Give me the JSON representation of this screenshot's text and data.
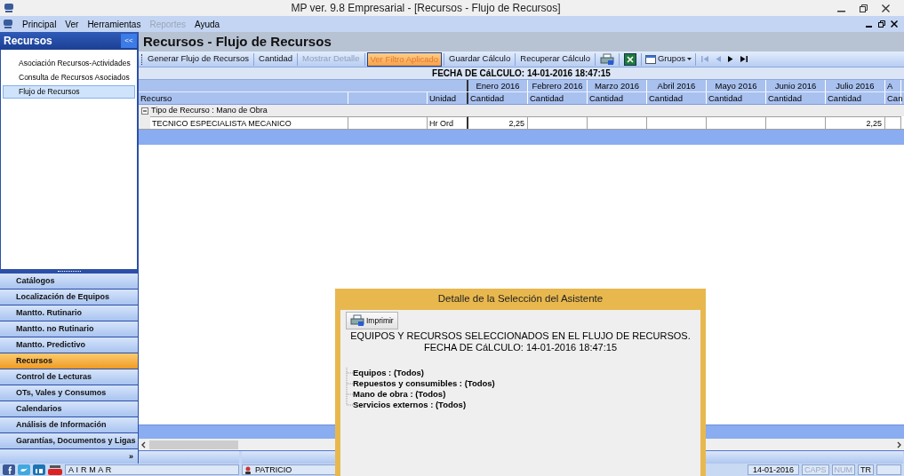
{
  "window": {
    "title": "MP ver. 9.8 Empresarial - [Recursos - Flujo de Recursos]"
  },
  "menu": [
    {
      "label": "Principal",
      "disabled": false
    },
    {
      "label": "Ver",
      "disabled": false
    },
    {
      "label": "Herramientas",
      "disabled": false
    },
    {
      "label": "Reportes",
      "disabled": true
    },
    {
      "label": "Ayuda",
      "disabled": false
    }
  ],
  "sidebar": {
    "title": "Recursos",
    "collapse": "<<",
    "items": [
      {
        "label": "Asociación Recursos-Actividades",
        "selected": false
      },
      {
        "label": "Consulta de Recursos Asociados",
        "selected": false
      },
      {
        "label": "Flujo de Recursos",
        "selected": true
      }
    ],
    "nav": [
      {
        "label": "Catálogos",
        "selected": false
      },
      {
        "label": "Localización de Equipos",
        "selected": false
      },
      {
        "label": "Mantto. Rutinario",
        "selected": false
      },
      {
        "label": "Mantto. no Rutinario",
        "selected": false
      },
      {
        "label": "Mantto. Predictivo",
        "selected": false
      },
      {
        "label": "Recursos",
        "selected": true
      },
      {
        "label": "Control de Lecturas",
        "selected": false
      },
      {
        "label": "OTs, Vales y Consumos",
        "selected": false
      },
      {
        "label": "Calendarios",
        "selected": false
      },
      {
        "label": "Análisis de Información",
        "selected": false
      },
      {
        "label": "Garantías, Documentos y Ligas",
        "selected": false
      }
    ],
    "more": "»"
  },
  "page": {
    "title": "Recursos - Flujo de Recursos"
  },
  "toolbar": [
    {
      "kind": "text",
      "label": "Generar Flujo de Recursos",
      "disabled": false,
      "highlighted": false
    },
    {
      "kind": "text",
      "label": "Cantidad",
      "disabled": false,
      "highlighted": false
    },
    {
      "kind": "text",
      "label": "Mostrar Detalle",
      "disabled": true,
      "highlighted": false
    },
    {
      "kind": "text",
      "label": "Ver Filtro Aplicado",
      "disabled": false,
      "highlighted": true
    },
    {
      "kind": "text",
      "label": "Guardar Cálculo",
      "disabled": false,
      "highlighted": false
    },
    {
      "kind": "text",
      "label": "Recuperar Cálculo",
      "disabled": false,
      "highlighted": false
    },
    {
      "kind": "print"
    },
    {
      "kind": "excel"
    },
    {
      "kind": "menu",
      "label": "Grupos",
      "disabled": false
    },
    {
      "kind": "first",
      "disabled": true
    },
    {
      "kind": "prev",
      "disabled": true
    },
    {
      "kind": "next",
      "disabled": false
    },
    {
      "kind": "last",
      "disabled": false
    }
  ],
  "calc_date": "FECHA DE CáLCULO: 14-01-2016 18:47:15",
  "table": {
    "resource_header": "Recurso",
    "unit_header": "Unidad",
    "months": [
      {
        "label": "Enero 2016",
        "sub": "Cantidad"
      },
      {
        "label": "Febrero 2016",
        "sub": "Cantidad"
      },
      {
        "label": "Marzo 2016",
        "sub": "Cantidad"
      },
      {
        "label": "Abril 2016",
        "sub": "Cantidad"
      },
      {
        "label": "Mayo 2016",
        "sub": "Cantidad"
      },
      {
        "label": "Junio 2016",
        "sub": "Cantidad"
      },
      {
        "label": "Julio 2016",
        "sub": "Cantidad"
      },
      {
        "label": "A",
        "sub": "Can"
      }
    ],
    "group": {
      "label": "Tipo de Recurso : Mano de Obra",
      "expanded": true
    },
    "rows": [
      {
        "resource": "TECNICO ESPECIALISTA MECANICO",
        "unit": "Hr Ord",
        "values": {
          "month_1": "2,25",
          "month_7": "2,25"
        }
      }
    ]
  },
  "dialog": {
    "title": "Detalle de la Selección del Asistente",
    "print": "Imprimir",
    "heading": "EQUIPOS Y RECURSOS SELECCIONADOS EN EL FLUJO DE RECURSOS.",
    "date": "FECHA DE CáLCULO: 14-01-2016 18:47:15",
    "items": [
      "Equipos : (Todos)",
      "Repuestos y consumibles : (Todos)",
      "Mano de obra : (Todos)",
      "Servicios externos : (Todos)"
    ]
  },
  "status_bar": {
    "company": "A I R M A R",
    "user": "PATRICIO",
    "date": "14-01-2016",
    "indicators": [
      {
        "label": "CAPS",
        "on": false
      },
      {
        "label": "NUM",
        "on": false
      },
      {
        "label": "TR",
        "on": true
      }
    ]
  }
}
